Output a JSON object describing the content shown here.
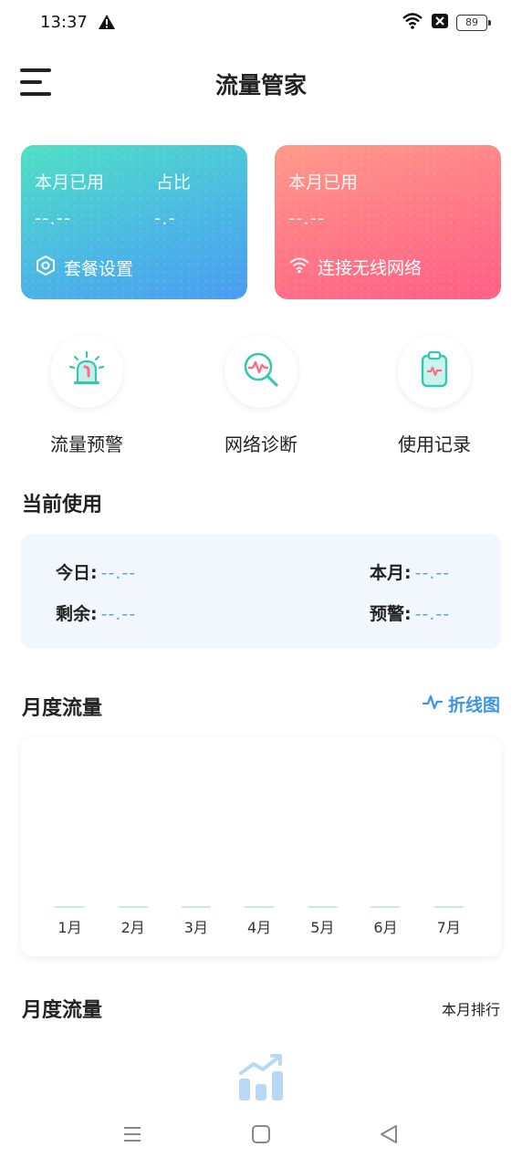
{
  "status_bar": {
    "time": "13:37",
    "battery": "89"
  },
  "header": {
    "title": "流量管家"
  },
  "cards": {
    "left": {
      "used_label": "本月已用",
      "used_value": "--.--",
      "ratio_label": "占比",
      "ratio_value": "-.-",
      "action_label": "套餐设置"
    },
    "right": {
      "used_label": "本月已用",
      "used_value": "--.--",
      "action_label": "连接无线网络"
    }
  },
  "quick_actions": [
    {
      "label": "流量预警",
      "icon": "alarm-light-icon"
    },
    {
      "label": "网络诊断",
      "icon": "diagnose-search-icon"
    },
    {
      "label": "使用记录",
      "icon": "clipboard-record-icon"
    }
  ],
  "current_usage": {
    "title": "当前使用",
    "today_label": "今日:",
    "today_value": "--.--",
    "month_label": "本月:",
    "month_value": "--.--",
    "remain_label": "剩余:",
    "remain_value": "--.--",
    "alert_label": "预警:",
    "alert_value": "--.--"
  },
  "monthly_chart": {
    "title": "月度流量",
    "toggle_label": "折线图"
  },
  "chart_data": {
    "type": "bar",
    "categories": [
      "1月",
      "2月",
      "3月",
      "4月",
      "5月",
      "6月",
      "7月"
    ],
    "values": [
      0,
      0,
      0,
      0,
      0,
      0,
      0
    ],
    "title": "",
    "xlabel": "",
    "ylabel": ""
  },
  "ranking": {
    "title": "月度流量",
    "link_label": "本月排行"
  },
  "colors": {
    "accent_blue": "#3f94e0",
    "teal": "#4fd8c4",
    "pink": "#ff6b86"
  }
}
